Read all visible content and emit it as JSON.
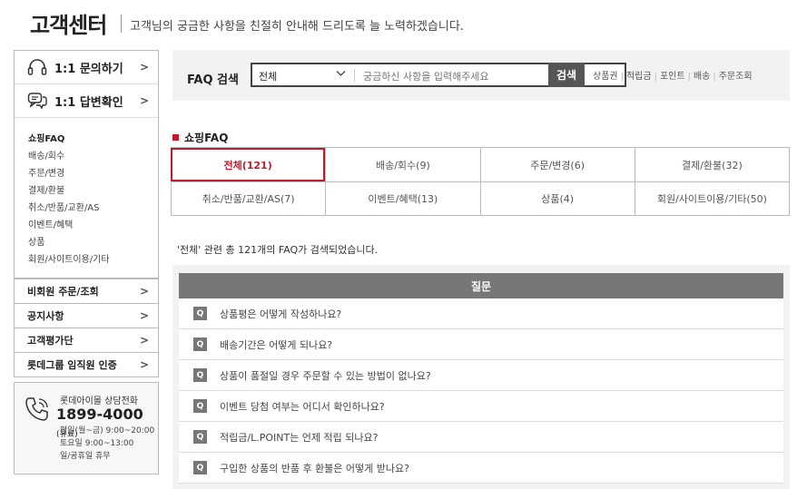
{
  "page": {
    "title": "고객센터",
    "subtitle": "고객님의 궁금한 사항을 친절히 안내해 드리도록 늘 노력하겠습니다."
  },
  "sidebar": {
    "main_items": [
      {
        "label": "1:1 문의하기",
        "icon": "headset-icon"
      },
      {
        "label": "1:1 답변확인",
        "icon": "chat-bubbles-icon"
      }
    ],
    "faq_list": [
      "쇼핑FAQ",
      "배송/회수",
      "주문/변경",
      "결제/환불",
      "취소/반품/교환/AS",
      "이벤트/혜택",
      "상품",
      "회원/사이트이용/기타"
    ],
    "links": [
      "비회원 주문/조회",
      "공지사항",
      "고객평가단",
      "롯데그룹 임직원 인증"
    ],
    "chevron": ">"
  },
  "phone": {
    "title": "롯데아이몰 상담전화",
    "number": "1899-4000",
    "fee": "(유료)",
    "hours": [
      "평일(월~금) 9:00~20:00",
      "토요일 9:00~13:00",
      "일/공휴일 휴무"
    ]
  },
  "search": {
    "label": "FAQ 검색",
    "select_value": "전체",
    "placeholder": "궁금하신 사항을 입력해주세요",
    "button": "검색",
    "quick_links": [
      "상품권",
      "적립금",
      "포인트",
      "배송",
      "주문조회"
    ]
  },
  "faq": {
    "heading": "쇼핑FAQ",
    "categories": [
      {
        "label": "전체(121)",
        "active": true
      },
      {
        "label": "배송/회수(9)"
      },
      {
        "label": "주문/변경(6)"
      },
      {
        "label": "결제/환불(32)"
      },
      {
        "label": "취소/반품/교환/AS(7)"
      },
      {
        "label": "이벤트/혜택(13)"
      },
      {
        "label": "상품(4)"
      },
      {
        "label": "회원/사이트이용/기타(50)"
      }
    ],
    "result_count": "'전체' 관련 총 121개의 FAQ가 검색되었습니다.",
    "table_header": "질문",
    "badge": "Q",
    "questions": [
      "상품평은 어떻게 작성하나요?",
      "배송기간은 어떻게 되나요?",
      "상품이 품절일 경우 주문할 수 있는 방법이 없나요?",
      "이벤트 당첨 여부는 어디서 확인하나요?",
      "적립금/L.POINT는 언제 적립 되나요?",
      "구입한 상품의 반품 후 환불은 어떻게 받나요?"
    ]
  },
  "colors": {
    "accent": "#c11b2c",
    "header_gray": "#777777"
  }
}
